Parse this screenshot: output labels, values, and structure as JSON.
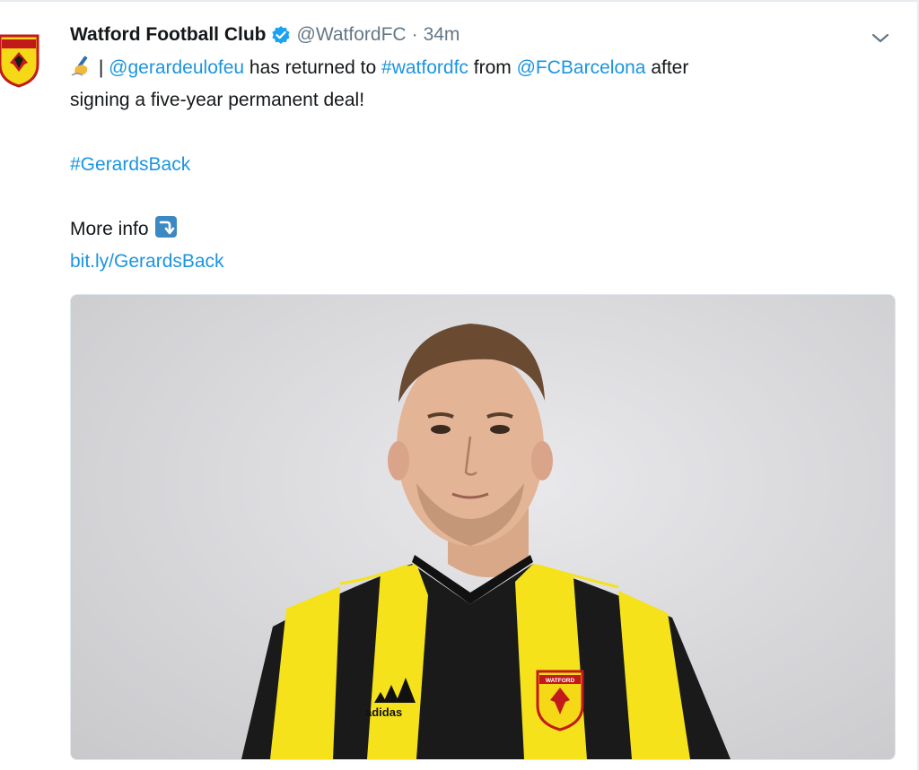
{
  "tweet": {
    "author_name": "Watford Football Club",
    "handle": "@WatfordFC",
    "separator": "·",
    "time": "34m",
    "text": {
      "separator": "|",
      "mention1": "@gerardeulofeu",
      "part1": "has returned to",
      "hashtag1": "#watfordfc",
      "part2": "from",
      "mention2": "@FCBarcelona",
      "part3": "after",
      "part4": "signing a five-year permanent deal!",
      "hashtag2": "#GerardsBack",
      "more_info": "More info",
      "link": "bit.ly/GerardsBack"
    },
    "icons": {
      "avatar": "watford-crest-icon",
      "verified": "verified-badge-icon",
      "menu": "chevron-down-icon",
      "writing_hand": "writing-hand-emoji-icon",
      "arrow": "right-arrow-curving-down-icon"
    },
    "photo": {
      "kit_brand": "adidas",
      "crest_text": "WATFORD"
    }
  },
  "colors": {
    "link": "#1b95e0",
    "secondary_text": "#657786",
    "verified": "#1da1f2",
    "kit_yellow": "#f5e21a",
    "kit_black": "#1a1a1a"
  }
}
